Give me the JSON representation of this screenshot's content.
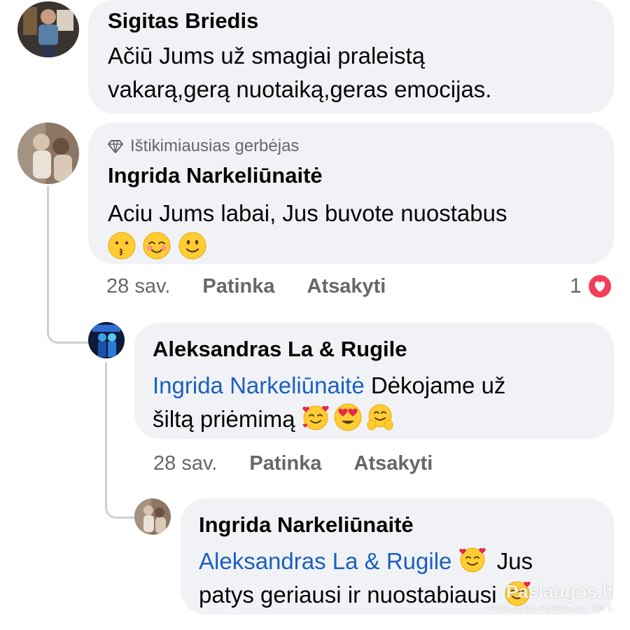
{
  "comments": [
    {
      "author": "Sigitas Briedis",
      "text_line1": "Ačiū Jums už smagiai praleistą",
      "text_line2": "vakarą,gerą nuotaiką,geras emocijas."
    },
    {
      "badge": "Ištikimiausias gerbėjas",
      "author": "Ingrida Narkeliūnaitė",
      "text": "Aciu Jums labai, Jus buvote nuostabus",
      "emojis": [
        "kissing-face-icon",
        "smiling-blush-icon",
        "slight-smile-icon"
      ],
      "time": "28 sav.",
      "like_label": "Patinka",
      "reply_label": "Atsakyti",
      "reaction_count": "1",
      "reaction_icon": "heart-reaction-icon"
    }
  ],
  "replies": [
    {
      "author": "Aleksandras La & Rugile",
      "mention": "Ingrida Narkeliūnaitė",
      "text_after_mention": " Dėkojame už",
      "text_line2": "šiltą priėmimą ",
      "emojis": [
        "smiling-hearts-icon",
        "heart-eyes-icon",
        "hugging-face-icon"
      ],
      "time": "28 sav.",
      "like_label": "Patinka",
      "reply_label": "Atsakyti"
    },
    {
      "author": "Ingrida Narkeliūnaitė",
      "mention": "Aleksandras La & Rugile",
      "text_after_emoji": " Jus",
      "text_line2": "patys geriausi ir nuostabiausi "
    }
  ],
  "watermark": {
    "title": "Paslaugos.lt",
    "subtitle": "PASLAUGŲ PORTALAS",
    "badge": "Nr.1"
  },
  "colors": {
    "bubble": "#f0f2f5",
    "mention": "#1b5fbf",
    "meta": "#65676b",
    "heart": "#f33e58"
  }
}
